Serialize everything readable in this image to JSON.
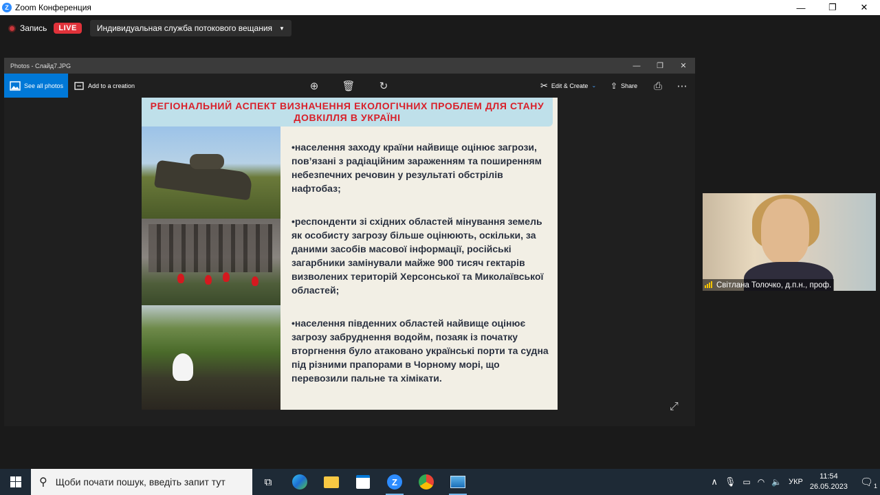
{
  "zoom": {
    "window_title": "Zoom Конференция",
    "recording_label": "Запись",
    "live_label": "LIVE",
    "stream_service": "Индивидуальная служба потокового вещания"
  },
  "photos": {
    "window_title": "Photos - Слайд7.JPG",
    "see_all_label": "See all photos",
    "add_creation_label": "Add to a creation",
    "edit_create_label": "Edit & Create",
    "share_label": "Share"
  },
  "slide": {
    "title_line1": "РЕГІОНАЛЬНИЙ АСПЕКТ ВИЗНАЧЕННЯ ЕКОЛОГІЧНИХ ПРОБЛЕМ ДЛЯ СТАНУ",
    "title_line2": "ДОВКІЛЛЯ В УКРАЇНІ",
    "bullets": [
      "•населення заходу країни найвище оцінює загрози, пов’язані з радіаційним зараженням та поширенням небезпечних речовин у результаті обстрілів нафтобаз;",
      "•респонденти зі східних областей мінування земель як особисту загрозу більше оцінюють, оскільки, за даними засобів масової інформації, російські загарбники замінували майже 900 тисяч гектарів визволених територій Херсонської та Миколаївської областей;",
      "•населення південних областей найвище оцінює загрозу забруднення водойм, позаяк із початку вторгнення було атаковано українські порти та судна під різними прапорами в Чорному морі, що перевозили пальне та хімікати."
    ]
  },
  "participant": {
    "name": "Світлана Толочко, д.п.н., проф."
  },
  "taskbar": {
    "search_placeholder": "Щоби почати пошук, введіть запит тут",
    "language": "УКР",
    "time": "11:54",
    "date": "26.05.2023",
    "notification_count": "1"
  }
}
